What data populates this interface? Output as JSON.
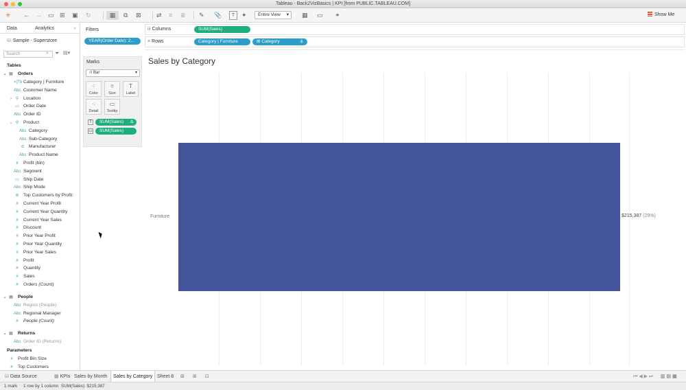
{
  "window": {
    "title": "Tableau - Back2VizBasics | KPI [from PUBLIC.TABLEAU.COM]"
  },
  "toolbar": {
    "fit_select": "Entire View",
    "show_me": "Show Me"
  },
  "data_pane": {
    "tab_data": "Data",
    "tab_analytics": "Analytics",
    "datasource": "Sample - Superstore",
    "search_placeholder": "Search",
    "tables_header": "Tables",
    "orders": {
      "name": "Orders",
      "fields": [
        {
          "icon": "=|Tb",
          "label": "Category | Furniture"
        },
        {
          "icon": "Abc",
          "label": "Customer Name"
        },
        {
          "icon": "geo",
          "label": "Location"
        },
        {
          "icon": "date",
          "label": "Order Date"
        },
        {
          "icon": "Abc",
          "label": "Order ID"
        },
        {
          "icon": "hier",
          "label": "Product"
        },
        {
          "icon": "Abc",
          "label": "Category"
        },
        {
          "icon": "Abc",
          "label": "Sub-Category"
        },
        {
          "icon": "clip",
          "label": "Manufacturer"
        },
        {
          "icon": "Abc",
          "label": "Product Name"
        },
        {
          "icon": "bin",
          "label": "Profit (bin)"
        },
        {
          "icon": "Abc",
          "label": "Segment"
        },
        {
          "icon": "date",
          "label": "Ship Date"
        },
        {
          "icon": "Abc",
          "label": "Ship Mode"
        },
        {
          "icon": "set",
          "label": "Top Customers by Profit"
        },
        {
          "icon": "#",
          "label": "Current Year Profit"
        },
        {
          "icon": "#",
          "label": "Current Year Quantity"
        },
        {
          "icon": "#",
          "label": "Current Year Sales"
        },
        {
          "icon": "#",
          "label": "Discount"
        },
        {
          "icon": "#",
          "label": "Prior Year Profit"
        },
        {
          "icon": "#",
          "label": "Prior Year Quantity"
        },
        {
          "icon": "#",
          "label": "Prior Year Sales"
        },
        {
          "icon": "#",
          "label": "Profit"
        },
        {
          "icon": "#",
          "label": "Quantity"
        },
        {
          "icon": "#",
          "label": "Sales"
        },
        {
          "icon": "#",
          "label": "Orders (Count)"
        }
      ]
    },
    "people": {
      "name": "People",
      "fields": [
        {
          "icon": "Abc",
          "label": "Region (People)"
        },
        {
          "icon": "Abc",
          "label": "Regional Manager"
        },
        {
          "icon": "#",
          "label": "People (Count)"
        }
      ]
    },
    "returns": {
      "name": "Returns",
      "fields": [
        {
          "icon": "Abc",
          "label": "Order ID (Returns)"
        }
      ]
    },
    "parameters_header": "Parameters",
    "parameters": [
      {
        "icon": "#",
        "label": "Profit Bin Size"
      },
      {
        "icon": "#",
        "label": "Top Customers"
      }
    ]
  },
  "filters": {
    "title": "Filters",
    "pill": "YEAR(Order Date): 2..."
  },
  "marks": {
    "title": "Marks",
    "type": "Bar",
    "buttons": [
      "Color",
      "Size",
      "Label",
      "Detail",
      "Tooltip"
    ],
    "pills": [
      "SUM(Sales)",
      "SUM(Sales)"
    ],
    "delta": "Δ"
  },
  "columns_shelf": {
    "label": "Columns",
    "pill": "SUM(Sales)"
  },
  "rows_shelf": {
    "label": "Rows",
    "pill1": "Category | Furniture",
    "pill2": "Category"
  },
  "view": {
    "title": "Sales by Category"
  },
  "chart_data": {
    "type": "bar",
    "orientation": "horizontal",
    "categories": [
      "Furniture"
    ],
    "values": [
      215387
    ],
    "labels": [
      "$215,387"
    ],
    "percent_labels": [
      "(29%)"
    ],
    "bar_color": "#44549a",
    "grid": true
  },
  "sheet_tabs": {
    "data_source": "Data Source",
    "tabs": [
      "KPIs",
      "Sales by Month",
      "Sales by Category",
      "Sheet 8"
    ],
    "active": "Sales by Category"
  },
  "status_bar": {
    "marks": "1 mark",
    "rows": "1 row by 1 column",
    "sum": "SUM(Sales): $215,387"
  }
}
